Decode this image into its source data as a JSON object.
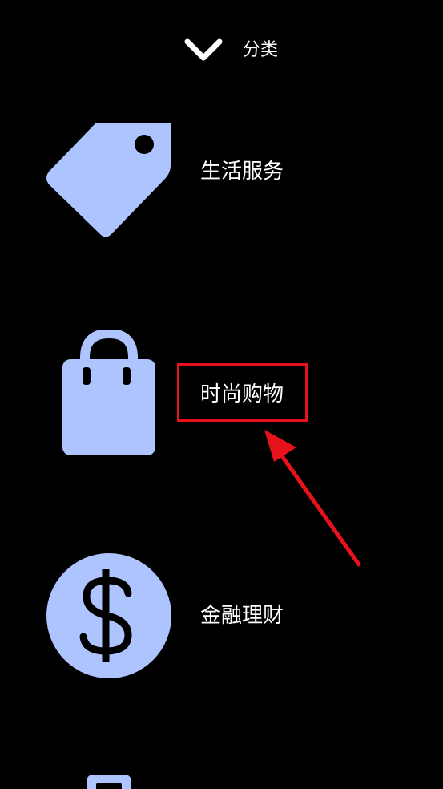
{
  "header": {
    "title": "分类",
    "collapse_icon": "chevron-down-icon"
  },
  "categories": [
    {
      "label": "生活服务",
      "icon": "price-tag-icon"
    },
    {
      "label": "时尚购物",
      "icon": "shopping-bag-icon",
      "highlighted": true
    },
    {
      "label": "金融理财",
      "icon": "dollar-coin-icon"
    },
    {
      "label": "",
      "icon": "partial-item-icon"
    }
  ],
  "colors": {
    "background": "#000000",
    "icon_fill": "#aec4ff",
    "text": "#ffffff",
    "annotation": "#e8121a"
  }
}
